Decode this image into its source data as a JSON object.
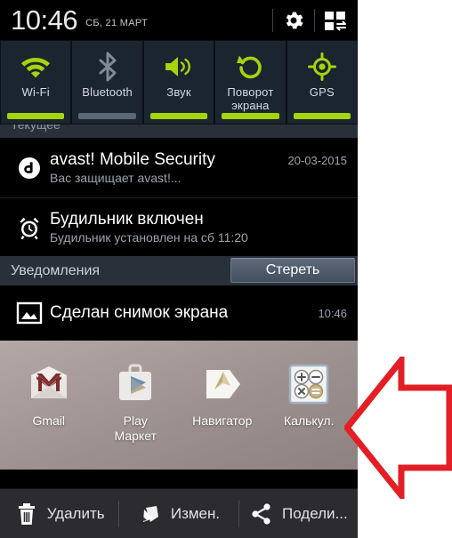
{
  "statusbar": {
    "clock": "10:46",
    "date": "СБ, 21 МАРТ",
    "gear_icon": "gear-icon",
    "panels_icon": "panels-icon"
  },
  "quick_toggles": [
    {
      "label": "Wi-Fi",
      "icon": "wifi-icon",
      "state": "on"
    },
    {
      "label": "Bluetooth",
      "icon": "bluetooth-icon",
      "state": "off"
    },
    {
      "label": "Звук",
      "icon": "volume-icon",
      "state": "on"
    },
    {
      "label": "Поворот\nэкрана",
      "label_line1": "Поворот",
      "label_line2": "экрана",
      "icon": "rotate-icon",
      "state": "on"
    },
    {
      "label": "GPS",
      "icon": "gps-icon",
      "state": "on"
    }
  ],
  "ongoing": {
    "header": "Текущее",
    "items": [
      {
        "icon": "avast-icon",
        "title": "avast! Mobile Security",
        "time": "20-03-2015",
        "subtitle": "Вас защищает avast!..."
      },
      {
        "icon": "alarm-icon",
        "title": "Будильник включен",
        "time": "",
        "subtitle": "Будильник установлен на сб 11:20"
      }
    ]
  },
  "notifications": {
    "header": "Уведомления",
    "clear_label": "Стереть",
    "items": [
      {
        "icon": "image-icon",
        "title": "Сделан снимок экрана",
        "time": "10:46",
        "subtitle": ""
      }
    ]
  },
  "home": {
    "apps": [
      {
        "label": "Gmail",
        "label_line2": "",
        "icon": "gmail-icon"
      },
      {
        "label": "Play",
        "label_line2": "Маркет",
        "icon": "play-store-icon"
      },
      {
        "label": "Навигатор",
        "label_line2": "",
        "icon": "navigator-icon"
      },
      {
        "label": "Калькул.",
        "label_line2": "",
        "icon": "calculator-icon"
      }
    ]
  },
  "actionbar": {
    "actions": [
      {
        "label": "Удалить",
        "icon": "trash-icon"
      },
      {
        "label": "Измен.",
        "icon": "pencil-icon"
      },
      {
        "label": "Подели...",
        "icon": "share-icon"
      }
    ]
  },
  "annotation": {
    "arrow": "left-arrow-annotation",
    "color": "#e31e24"
  },
  "colors": {
    "accent_green": "#a3d40c",
    "tile_bg": "#1a2530",
    "panel_bg": "#2a3039",
    "notif_bg": "#000000",
    "arrow_red": "#e31e24"
  }
}
